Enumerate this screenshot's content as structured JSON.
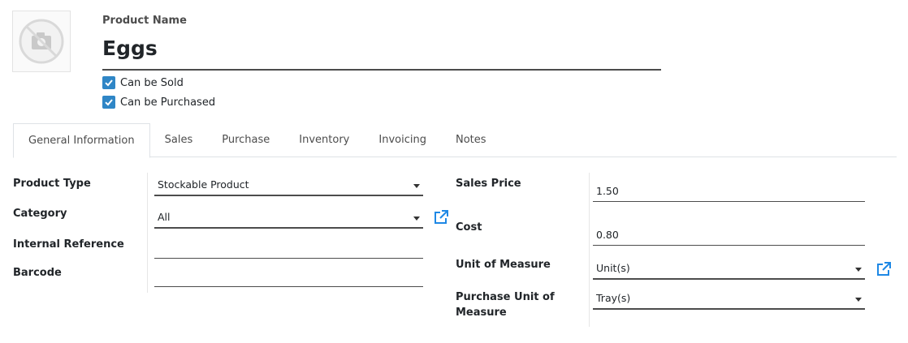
{
  "product": {
    "name_label": "Product Name",
    "name_value": "Eggs",
    "image_icon": "camera-icon"
  },
  "checkboxes": [
    {
      "label": "Can be Sold",
      "checked": true
    },
    {
      "label": "Can be Purchased",
      "checked": true
    }
  ],
  "tabs": [
    {
      "label": "General Information",
      "active": true
    },
    {
      "label": "Sales"
    },
    {
      "label": "Purchase"
    },
    {
      "label": "Inventory"
    },
    {
      "label": "Invoicing"
    },
    {
      "label": "Notes"
    }
  ],
  "left_fields": {
    "product_type": {
      "label": "Product Type",
      "value": "Stockable Product"
    },
    "category": {
      "label": "Category",
      "value": "All"
    },
    "internal_reference": {
      "label": "Internal Reference",
      "value": ""
    },
    "barcode": {
      "label": "Barcode",
      "value": ""
    }
  },
  "right_fields": {
    "sales_price": {
      "label": "Sales Price",
      "value": "1.50"
    },
    "cost": {
      "label": "Cost",
      "value": "0.80"
    },
    "uom": {
      "label": "Unit of Measure",
      "value": "Unit(s)"
    },
    "purchase_uom": {
      "label_line1": "Purchase Unit of",
      "label_line2": "Measure",
      "value": "Tray(s)"
    }
  },
  "colors": {
    "accent": "#2f86c6",
    "link_icon": "#1e88e5"
  }
}
